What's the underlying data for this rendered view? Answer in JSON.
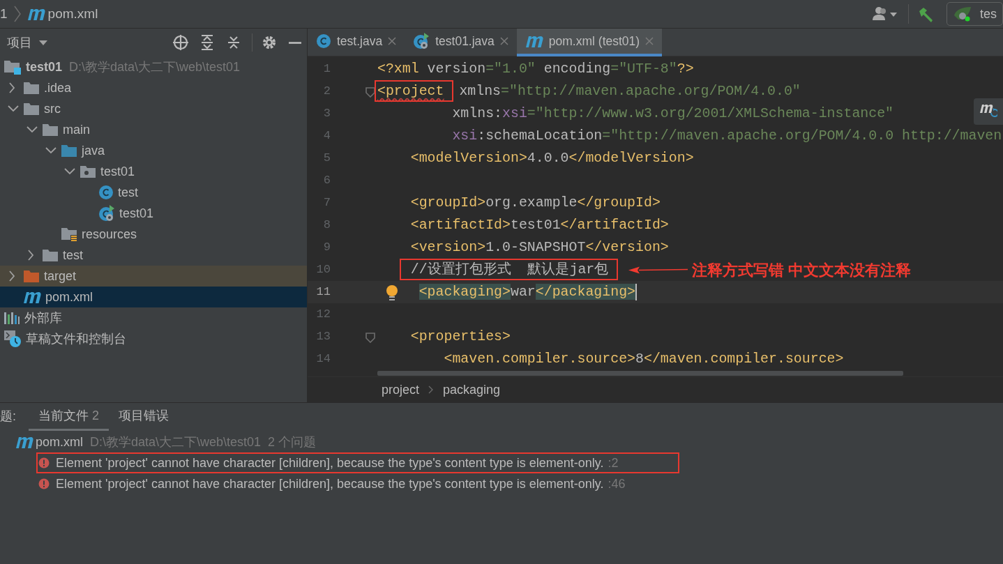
{
  "title_bar": {
    "breadcrumbs": [
      {
        "text": "1"
      },
      {
        "text": "pom.xml",
        "kind": "maven"
      }
    ],
    "run_config": {
      "label": "tes"
    }
  },
  "project_panel": {
    "title": "项目",
    "tree": [
      {
        "label": "test01",
        "path": "D:\\教学data\\大二下\\web\\test01",
        "kind": "module",
        "selected": false,
        "children": [
          {
            "label": ".idea",
            "kind": "folder",
            "expanded": false,
            "selected": false
          },
          {
            "label": "src",
            "kind": "folder",
            "expanded": true,
            "selected": false,
            "children": [
              {
                "label": "main",
                "kind": "folder",
                "expanded": true,
                "selected": false,
                "children": [
                  {
                    "label": "java",
                    "kind": "source-folder",
                    "expanded": true,
                    "selected": false,
                    "children": [
                      {
                        "label": "test01",
                        "kind": "package",
                        "expanded": true,
                        "selected": false,
                        "children": [
                          {
                            "label": "test",
                            "kind": "class",
                            "selected": false
                          },
                          {
                            "label": "test01",
                            "kind": "main-class",
                            "selected": false
                          }
                        ]
                      }
                    ]
                  },
                  {
                    "label": "resources",
                    "kind": "resources-folder",
                    "selected": false
                  }
                ]
              },
              {
                "label": "test",
                "kind": "folder",
                "expanded": false,
                "selected": false
              }
            ]
          },
          {
            "label": "target",
            "kind": "excluded-folder",
            "expanded": false,
            "selected": false
          },
          {
            "label": "pom.xml",
            "kind": "maven",
            "selected": true
          }
        ]
      },
      {
        "label": "外部库",
        "kind": "libraries",
        "selected": false
      },
      {
        "label": "草稿文件和控制台",
        "kind": "scratches",
        "selected": false
      }
    ]
  },
  "editor": {
    "tabs": [
      {
        "label": "test.java",
        "kind": "class",
        "selected": false
      },
      {
        "label": "test01.java",
        "kind": "main-class",
        "selected": false
      },
      {
        "label": "pom.xml (test01)",
        "kind": "maven",
        "selected": true
      }
    ],
    "lines": [
      {
        "number": "1",
        "tokens": [
          {
            "kind": "tag",
            "text": "<?xml"
          },
          {
            "kind": "text",
            "text": " version"
          },
          {
            "kind": "str",
            "text": "=\"1.0\""
          },
          {
            "kind": "text",
            "text": " encoding"
          },
          {
            "kind": "str",
            "text": "=\"UTF-8\""
          },
          {
            "kind": "tag",
            "text": "?>"
          }
        ]
      },
      {
        "number": "2",
        "fold": true,
        "tokens": [
          {
            "kind": "tag",
            "text": "<project",
            "error": true,
            "boxed": true
          },
          {
            "kind": "text",
            "text": "xmlns"
          },
          {
            "kind": "str",
            "text": "=\"http://maven.apache.org/POM/4.0.0\""
          }
        ]
      },
      {
        "number": "3",
        "tokens": [
          {
            "kind": "text",
            "text": "         xmlns:"
          },
          {
            "kind": "ns",
            "text": "xsi"
          },
          {
            "kind": "str",
            "text": "=\"http://www.w3.org/2001/XMLSchema-instance\""
          }
        ]
      },
      {
        "number": "4",
        "tokens": [
          {
            "kind": "ns",
            "text": "         xsi"
          },
          {
            "kind": "text",
            "text": ":schemaLocation"
          },
          {
            "kind": "str",
            "text": "=\"http://maven.apache.org/POM/4.0.0 http://maven"
          }
        ]
      },
      {
        "number": "5",
        "tokens": [
          {
            "kind": "tag",
            "text": "    <modelVersion>"
          },
          {
            "kind": "text",
            "text": "4.0.0"
          },
          {
            "kind": "tag",
            "text": "</modelVersion>"
          }
        ]
      },
      {
        "number": "6"
      },
      {
        "number": "7",
        "tokens": [
          {
            "kind": "tag",
            "text": "    <groupId>"
          },
          {
            "kind": "text",
            "text": "org.example"
          },
          {
            "kind": "tag",
            "text": "</groupId>"
          }
        ]
      },
      {
        "number": "8",
        "tokens": [
          {
            "kind": "tag",
            "text": "    <artifactId>"
          },
          {
            "kind": "text",
            "text": "test01"
          },
          {
            "kind": "tag",
            "text": "</artifactId>"
          }
        ]
      },
      {
        "number": "9",
        "tokens": [
          {
            "kind": "tag",
            "text": "    <version>"
          },
          {
            "kind": "text",
            "text": "1.0-SNAPSHOT"
          },
          {
            "kind": "tag",
            "text": "</version>"
          }
        ]
      },
      {
        "number": "10",
        "tokens": [
          {
            "kind": "text",
            "text": "    //设置打包形式  默认是jar包",
            "boxed": true
          }
        ],
        "callout": "注释方式写错 中文文本没有注释"
      },
      {
        "number": "11",
        "current": true,
        "bulb": true,
        "caret": true,
        "tokens": [
          {
            "kind": "tag",
            "text": "     <packaging>",
            "matched": true
          },
          {
            "kind": "text",
            "text": "war"
          },
          {
            "kind": "tag",
            "text": "</packaging>",
            "matched": true
          }
        ]
      },
      {
        "number": "12"
      },
      {
        "number": "13",
        "fold": true,
        "tokens": [
          {
            "kind": "tag",
            "text": "    <properties>"
          }
        ]
      },
      {
        "number": "14",
        "tokens": [
          {
            "kind": "tag",
            "text": "        <maven.compiler.source>"
          },
          {
            "kind": "text",
            "text": "8"
          },
          {
            "kind": "tag",
            "text": "</maven.compiler.source>"
          }
        ]
      }
    ],
    "breadcrumbs": [
      "project",
      "packaging"
    ]
  },
  "problems": {
    "label": "题:",
    "tabs": [
      {
        "label": "当前文件",
        "count": "2",
        "selected": true
      },
      {
        "label": "项目错误",
        "selected": false
      }
    ],
    "file": {
      "name": "pom.xml",
      "path": "D:\\教学data\\大二下\\web\\test01",
      "count": "2 个问题"
    },
    "items": [
      {
        "message": "Element 'project' cannot have character [children], because the type's content type is element-only.",
        "line": ":2",
        "boxed": true
      },
      {
        "message": "Element 'project' cannot have character [children], because the type's content type is element-only.",
        "line": ":46"
      }
    ]
  }
}
